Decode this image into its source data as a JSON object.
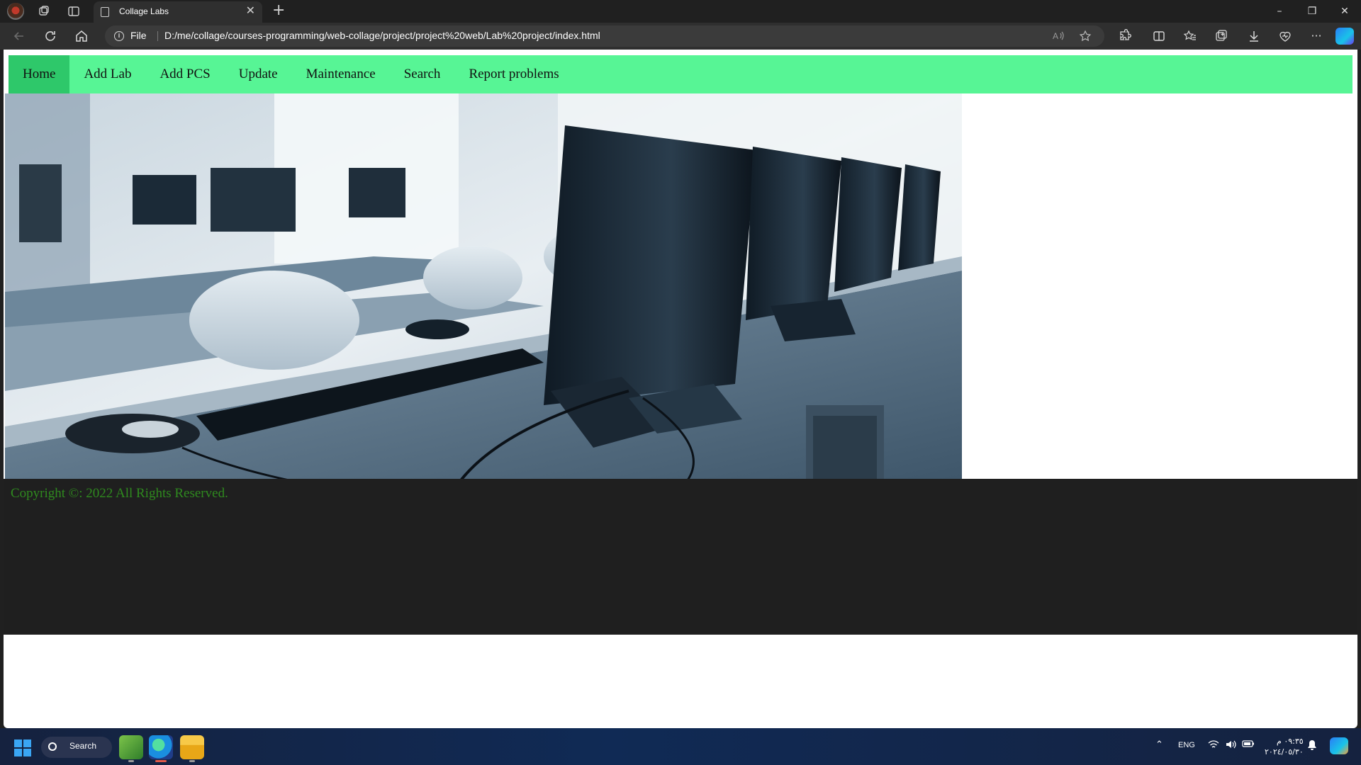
{
  "browser": {
    "tab_title": "Collage Labs",
    "url": "D:/me/collage/courses-programming/web-collage/project/project%20web/Lab%20project/index.html",
    "file_label": "File",
    "new_tab_symbol": "+",
    "close_symbol": "✕",
    "minimize_symbol": "–",
    "restore_symbol": "❐",
    "window_close_symbol": "✕",
    "more_symbol": "···"
  },
  "site": {
    "nav": [
      {
        "label": "Home",
        "active": true
      },
      {
        "label": "Add Lab",
        "active": false
      },
      {
        "label": "Add PCS",
        "active": false
      },
      {
        "label": "Update",
        "active": false
      },
      {
        "label": "Maintenance",
        "active": false
      },
      {
        "label": "Search",
        "active": false
      },
      {
        "label": "Report problems",
        "active": false
      }
    ],
    "footer": "Copyright ©: 2022 All Rights Reserved.",
    "colors": {
      "nav_bg": "#57f595",
      "nav_active": "#2ec86a",
      "footer_bg": "#1f1f1f",
      "footer_text": "#2f8a1f"
    }
  },
  "taskbar": {
    "search_label": "Search",
    "language": "ENG",
    "time": "٠٩:٣٥ م",
    "date": "٢٠٢٤/٠٥/٣٠"
  }
}
